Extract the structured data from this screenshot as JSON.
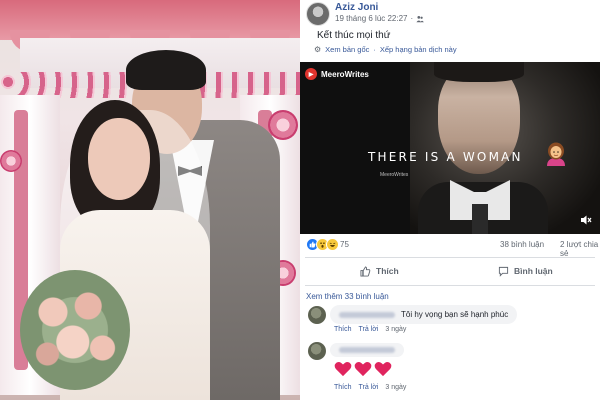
{
  "post": {
    "author": "Aziz Joni",
    "timestamp": "19 tháng 6 lúc 22:27",
    "privacy_icon": "friends-icon",
    "text": "Kết thúc mọi thứ",
    "see_original": "Xem bản gốc",
    "rate_translation": "Xếp hạng bản dịch này"
  },
  "video": {
    "channel": "MeeroWrites",
    "caption": "THERE IS A WOMAN",
    "watermark": "MeeroWrites",
    "mute_icon": "speaker-mute-icon"
  },
  "stats": {
    "reactions_count": "75",
    "comments": "38 bình luận",
    "shares": "2 lượt chia sẻ"
  },
  "actions": {
    "like": "Thích",
    "comment": "Bình luận"
  },
  "comments_section": {
    "more_comments": "Xem thêm 33 bình luận",
    "items": [
      {
        "text": "Tôi hy vọng bạn sẽ hạnh phúc",
        "like": "Thích",
        "reply": "Trả lời",
        "time": "3 ngày"
      },
      {
        "text": "",
        "like": "Thích",
        "reply": "Trả lời",
        "time": "3 ngày"
      }
    ]
  },
  "colors": {
    "link": "#385898",
    "muted": "#606770",
    "like_blue": "#2078f4",
    "heart_red": "#e0245e"
  }
}
